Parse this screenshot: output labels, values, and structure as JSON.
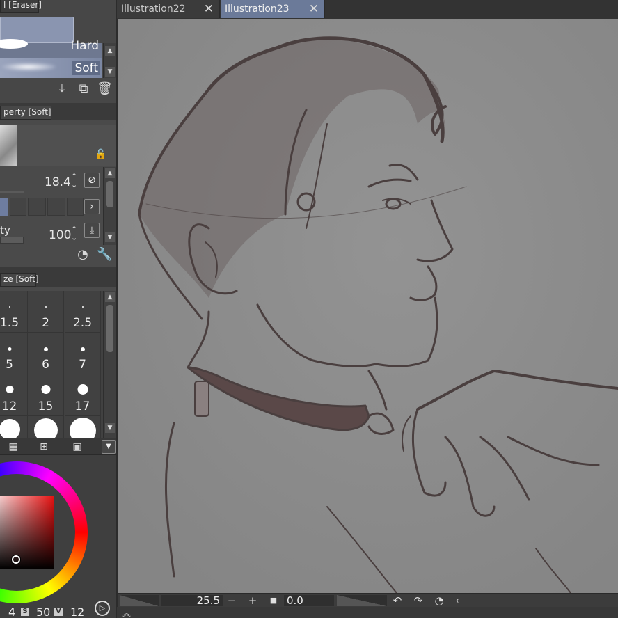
{
  "tool_panel": {
    "title": "l [Eraser]",
    "brushes": [
      {
        "name": "Hard"
      },
      {
        "name": "Soft"
      }
    ]
  },
  "property_panel": {
    "title": "perty [Soft]",
    "size_value": "18.4",
    "opacity_label": "ty",
    "opacity_value": "100"
  },
  "brush_size_panel": {
    "title": "ze [Soft]",
    "sizes": [
      "1.5",
      "2",
      "2.5",
      "5",
      "6",
      "7",
      "12",
      "15",
      "17"
    ]
  },
  "color_panel": {
    "h_value": "4",
    "s_label": "S",
    "s_value": "50",
    "v_label": "V",
    "v_value": "12"
  },
  "doc_tabs": [
    {
      "label": "Illustration22"
    },
    {
      "label": "Illustration23"
    }
  ],
  "status_bar": {
    "zoom": "25.5",
    "rotation": "0.0"
  },
  "colors": {
    "accent_tab": "#6b7a99",
    "panel_bg": "#4a4a4a",
    "canvas_bg": "#8d8d8d",
    "brush_preview": "#8a95b0"
  }
}
